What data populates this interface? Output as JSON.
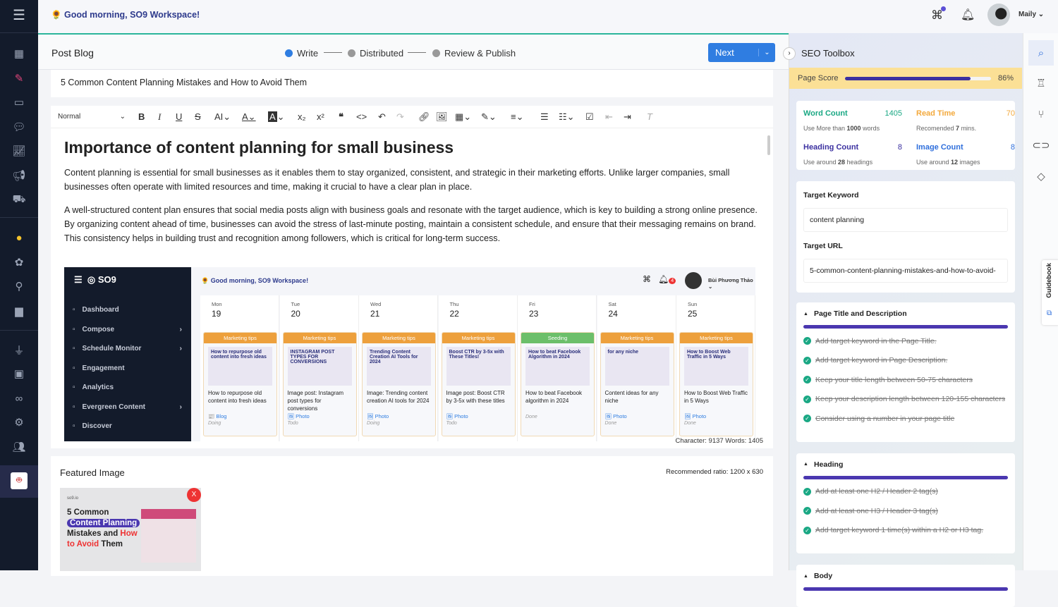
{
  "header": {
    "greeting": "🌻 Good morning, SO9 Workspace!",
    "user_name": "Maily"
  },
  "left_sidebar": {
    "icons": [
      "menu-icon",
      "dashboard-icon",
      "compose-icon",
      "schedule-icon",
      "engagement-icon",
      "analytics-icon",
      "megaphone-icon",
      "discover-icon",
      "coin-icon",
      "plant-icon",
      "bulb-icon",
      "folder-icon",
      "plugin-icon",
      "wallet-icon",
      "link-icon",
      "settings-icon",
      "users-icon",
      "avatar-robot-icon"
    ],
    "active_color": "#e0457b"
  },
  "post": {
    "page_title": "Post Blog",
    "steps": [
      "Write",
      "Distributed",
      "Review & Publish"
    ],
    "next_label": "Next",
    "title_value": "5 Common Content Planning Mistakes and How to Avoid Them"
  },
  "toolbar": {
    "style_select": "Normal"
  },
  "content": {
    "heading": "Importance of content planning for small business",
    "paragraphs": [
      "Content planning is essential for small businesses as it enables them to stay organized, consistent, and strategic in their marketing efforts. Unlike larger companies, small businesses often operate with limited resources and time, making it crucial to have a clear plan in place.",
      "A well-structured content plan ensures that social media posts align with business goals and resonate with the target audience, which is key to building a strong online presence. By organizing content ahead of time, businesses can avoid the stress of last-minute posting, maintain a consistent schedule, and ensure that their messaging remains on brand. This consistency helps in building trust and recognition among followers, which is critical for long-term success."
    ],
    "stats": "Character: 9137  Words: 1405"
  },
  "embedded": {
    "brand": "SO9",
    "greeting": "🌻 Good morning, SO9 Workspace!",
    "user": "Bùi Phương Thảo",
    "notif_count": "4",
    "menu": [
      {
        "label": "Dashboard",
        "chev": ""
      },
      {
        "label": "Compose",
        "chev": "›"
      },
      {
        "label": "Schedule Monitor",
        "chev": "›"
      },
      {
        "label": "Engagement",
        "chev": ""
      },
      {
        "label": "Analytics",
        "chev": ""
      },
      {
        "label": "Evergreen Content",
        "chev": "›"
      },
      {
        "label": "Discover",
        "chev": ""
      }
    ],
    "days": [
      {
        "dow": "Mon",
        "date": "19",
        "tag": "Marketing tips",
        "tag_color": "#eda03c",
        "img": "How to repurpose old content into fresh ideas",
        "title": "How to repurpose old content into fresh ideas",
        "type": "📰 Blog",
        "status": "Doing"
      },
      {
        "dow": "Tue",
        "date": "20",
        "tag": "Marketing tips",
        "tag_color": "#eda03c",
        "img": "INSTAGRAM POST TYPES FOR CONVERSIONS",
        "title": "Image post: Instagram post types for conversions",
        "type": "🖼 Photo",
        "status": "Todo"
      },
      {
        "dow": "Wed",
        "date": "21",
        "tag": "Marketing tips",
        "tag_color": "#eda03c",
        "img": "Trending Content Creation AI Tools for 2024",
        "title": "Image: Trending content creation AI tools for 2024",
        "type": "🖼 Photo",
        "status": "Doing"
      },
      {
        "dow": "Thu",
        "date": "22",
        "tag": "Marketing tips",
        "tag_color": "#eda03c",
        "img": "Boost CTR by 3-5x with These Titles!",
        "title": "Image post: Boost CTR by 3-5x with these titles",
        "type": "🖼 Photo",
        "status": "Todo"
      },
      {
        "dow": "Fri",
        "date": "23",
        "tag": "Seeding",
        "tag_color": "#6cbf6a",
        "img": "How to beat Facebook Algorithm in 2024",
        "title": "How to beat Facebook algorithm in 2024",
        "type": "",
        "status": "Done"
      },
      {
        "dow": "Sat",
        "date": "24",
        "tag": "Marketing tips",
        "tag_color": "#eda03c",
        "img": "for any niche",
        "title": "Content ideas for any niche",
        "type": "🖼 Photo",
        "status": "Done"
      },
      {
        "dow": "Sun",
        "date": "25",
        "tag": "Marketing tips",
        "tag_color": "#eda03c",
        "img": "How to Boost Web Traffic in 5 Ways",
        "title": "How to Boost Web Traffic in 5 Ways",
        "type": "🖼 Photo",
        "status": "Done"
      }
    ]
  },
  "featured": {
    "label": "Featured Image",
    "ratio": "Recommended ratio: 1200 x 630",
    "brand": "so9.io",
    "line1": "5 Common",
    "line2": "Content Planning",
    "line3a": "Mistakes and ",
    "line3b": "How",
    "line4a": "to Avoid",
    "line4b": " Them",
    "remove": "X"
  },
  "seo": {
    "title": "SEO Toolbox",
    "score_label": "Page Score",
    "score_value": "86%",
    "score_fraction": 0.86,
    "metrics": [
      {
        "label": "Word Count",
        "value": "1405",
        "hint_a": "Use More than ",
        "hint_b": "1000",
        "hint_c": " words",
        "color": "#1aa884"
      },
      {
        "label": "Read Time",
        "value": "70",
        "hint_a": "Recomended ",
        "hint_b": "7",
        "hint_c": " mins.",
        "color": "#f3a93c"
      },
      {
        "label": "Heading Count",
        "value": "8",
        "hint_a": "Use around ",
        "hint_b": "28",
        "hint_c": " headings",
        "color": "#3b30a0"
      },
      {
        "label": "Image Count",
        "value": "8",
        "hint_a": "Use around ",
        "hint_b": "12",
        "hint_c": " images",
        "color": "#2f6fdc"
      }
    ],
    "keyword_label": "Target Keyword",
    "keyword_value": "content planning",
    "url_label": "Target URL",
    "url_value": "5-common-content-planning-mistakes-and-how-to-avoid-",
    "sections": [
      {
        "title": "Page Title and Description",
        "items": [
          "Add target keyword in the Page Title.",
          "Add target keyword in Page Description.",
          "Keep your title length between 50-75 characters",
          "Keep your description length between 120-155 characters",
          "Consider using a number in your page title"
        ]
      },
      {
        "title": "Heading",
        "items": [
          "Add at least one H2 / Header 2 tag(s)",
          "Add at least one H3 / Header 3 tag(s)",
          "Add target keyword 1 time(s) within a H2 or H3 tag."
        ]
      },
      {
        "title": "Body",
        "items": []
      }
    ],
    "guidebook": "Guidebook"
  },
  "right_rail": {
    "icons": [
      "chat-search-icon",
      "robot-icon",
      "branch-icon",
      "vr-icon",
      "tag-icon"
    ]
  }
}
